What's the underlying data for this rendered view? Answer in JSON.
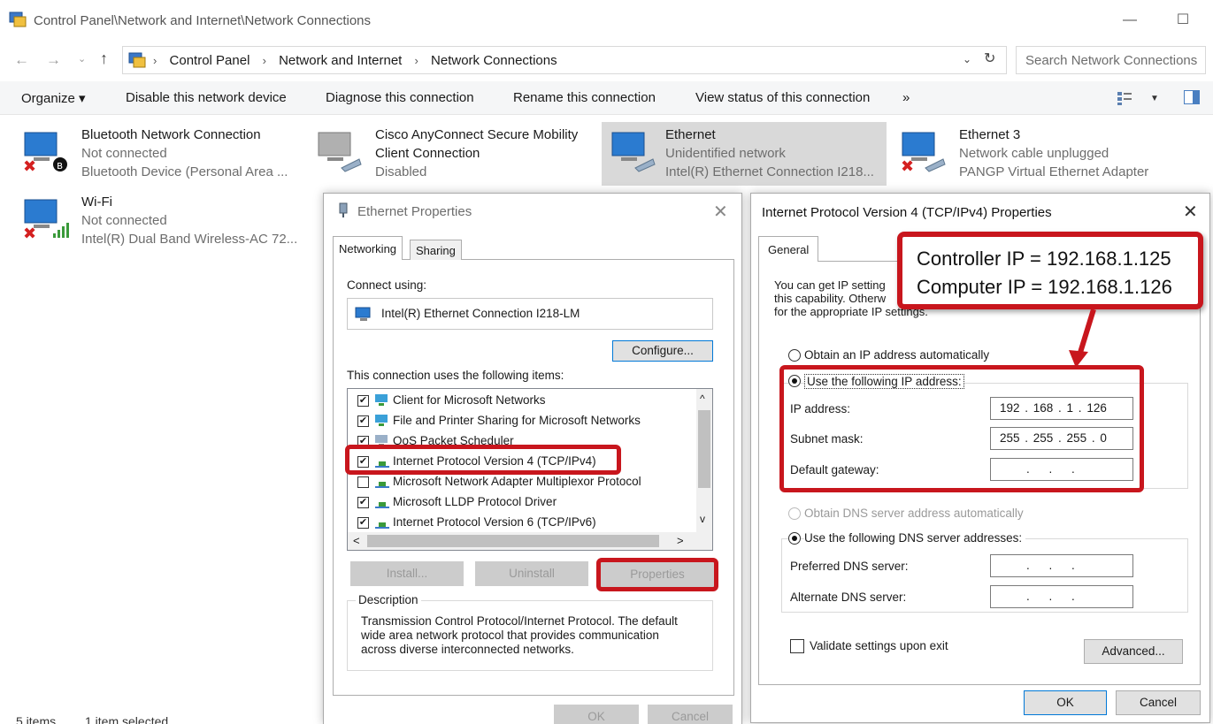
{
  "window": {
    "title": "Control Panel\\Network and Internet\\Network Connections",
    "minimize": "—",
    "maximize": "☐"
  },
  "address": {
    "back": "←",
    "forward": "→",
    "recent": "⌄",
    "up": "↑",
    "crumbs": [
      "Control Panel",
      "Network and Internet",
      "Network Connections"
    ],
    "separator": "›",
    "dropdown": "⌄",
    "refresh": "↻",
    "search_placeholder": "Search Network Connections"
  },
  "commandbar": {
    "organize": "Organize ▾",
    "disable": "Disable this network device",
    "diagnose": "Diagnose this connection",
    "rename": "Rename this connection",
    "view_status": "View status of this connection",
    "more": "»",
    "view_dropdown": "▼"
  },
  "connections": [
    {
      "name": "Bluetooth Network Connection",
      "status": "Not connected",
      "device": "Bluetooth Device (Personal Area ..."
    },
    {
      "name": "Cisco AnyConnect Secure Mobility",
      "name2": "Client Connection",
      "status": "Disabled"
    },
    {
      "name": "Ethernet",
      "status": "Unidentified network",
      "device": "Intel(R) Ethernet Connection I218..."
    },
    {
      "name": "Ethernet 3",
      "status": "Network cable unplugged",
      "device": "PANGP Virtual Ethernet Adapter"
    },
    {
      "name": "Wi-Fi",
      "status": "Not connected",
      "device": "Intel(R) Dual Band Wireless-AC 72..."
    }
  ],
  "statusbar": {
    "items": "5 items",
    "selected": "1 item selected"
  },
  "eth_dialog": {
    "title": "Ethernet Properties",
    "close": "✕",
    "tabs": [
      "Networking",
      "Sharing"
    ],
    "connect_using_label": "Connect using:",
    "adapter": "Intel(R) Ethernet Connection I218-LM",
    "configure": "Configure...",
    "items_label": "This connection uses the following items:",
    "items": [
      {
        "label": "Client for Microsoft Networks",
        "checked": true
      },
      {
        "label": "File and Printer Sharing for Microsoft Networks",
        "checked": true
      },
      {
        "label": "QoS Packet Scheduler",
        "checked": true
      },
      {
        "label": "Internet Protocol Version 4 (TCP/IPv4)",
        "checked": true
      },
      {
        "label": "Microsoft Network Adapter Multiplexor Protocol",
        "checked": false
      },
      {
        "label": "Microsoft LLDP Protocol Driver",
        "checked": true
      },
      {
        "label": "Internet Protocol Version 6 (TCP/IPv6)",
        "checked": true
      }
    ],
    "check": "✔",
    "scroll_up": "^",
    "scroll_down": "v",
    "scroll_left": "<",
    "scroll_right": ">",
    "install": "Install...",
    "uninstall": "Uninstall",
    "properties": "Properties",
    "description_label": "Description",
    "description": "Transmission Control Protocol/Internet Protocol. The default wide area network protocol that provides communication across diverse interconnected networks.",
    "ok": "OK",
    "cancel": "Cancel"
  },
  "ipv4_dialog": {
    "title": "Internet Protocol Version 4 (TCP/IPv4) Properties",
    "close": "✕",
    "tab": "General",
    "intro_line1": "You can get IP setting",
    "intro_line2": "this capability. Otherw",
    "intro_line3": "for the appropriate IP settings.",
    "obtain_ip": "Obtain an IP address automatically",
    "use_ip": "Use the following IP address:",
    "ip_label": "IP address:",
    "ip_value": "192 . 168 . 1 . 126",
    "subnet_label": "Subnet mask:",
    "subnet_value": "255 . 255 . 255 . 0",
    "gateway_label": "Default gateway:",
    "empty_ip": ". . .",
    "obtain_dns": "Obtain DNS server address automatically",
    "use_dns": "Use the following DNS server addresses:",
    "preferred_dns_label": "Preferred DNS server:",
    "alternate_dns_label": "Alternate DNS server:",
    "validate": "Validate settings upon exit",
    "advanced": "Advanced...",
    "ok": "OK",
    "cancel": "Cancel"
  },
  "callout": {
    "line1": "Controller IP = 192.168.1.125",
    "line2": "Computer IP = 192.168.1.126"
  },
  "colors": {
    "highlight": "#c8161d",
    "selected_bg": "#cce8ff",
    "accent": "#0078d7"
  }
}
